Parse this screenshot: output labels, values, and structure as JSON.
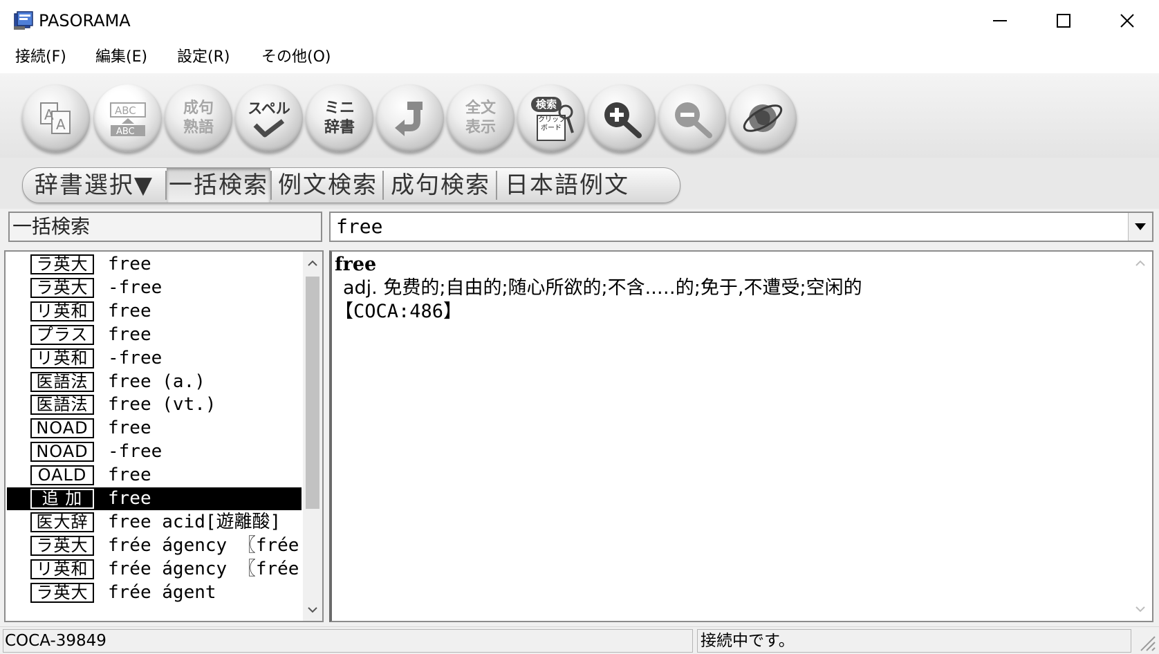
{
  "window": {
    "title": "PASORAMA"
  },
  "menu": [
    "接続(F)",
    "編集(E)",
    "設定(R)",
    "その他(O)"
  ],
  "toolbar": {
    "spell": "スペル",
    "mini_dict": "ミニ\n辞書",
    "idiom": "成句\n熟語",
    "full_text": "全文\n表示",
    "search_clip": "検索",
    "clipboard": "クリップ\nボード"
  },
  "tabs": [
    "辞書選択▼",
    "一括検索",
    "例文検索",
    "成句検索",
    "日本語例文"
  ],
  "search": {
    "mode": "一括検索",
    "value": "free"
  },
  "results": [
    {
      "dict": "ラ英大",
      "entry": "free"
    },
    {
      "dict": "ラ英大",
      "entry": "-free"
    },
    {
      "dict": "リ英和",
      "entry": "free"
    },
    {
      "dict": "プラス",
      "entry": "free"
    },
    {
      "dict": "リ英和",
      "entry": "-free"
    },
    {
      "dict": "医語法",
      "entry": "free (a.)"
    },
    {
      "dict": "医語法",
      "entry": "free (vt.)"
    },
    {
      "dict": "NOAD",
      "entry": "free"
    },
    {
      "dict": "NOAD",
      "entry": "-free"
    },
    {
      "dict": "OALD",
      "entry": "free"
    },
    {
      "dict": "追 加",
      "entry": "free",
      "selected": true
    },
    {
      "dict": "医大辞",
      "entry": "free acid[遊離酸]"
    },
    {
      "dict": "ラ英大",
      "entry": "frée ágency 〖frée"
    },
    {
      "dict": "リ英和",
      "entry": "frée ágency 〖frée"
    },
    {
      "dict": "ラ英大",
      "entry": "frée ágent"
    }
  ],
  "definition": {
    "headword": "free",
    "line1": "adj. 免费的;自由的;随心所欲的;不含..…的;免于,不遭受;空闲的",
    "line2": "【COCA:486】"
  },
  "status": {
    "left": "COCA-39849",
    "right": "接続中です。"
  },
  "colors": {
    "selection": "#000000",
    "chrome": "#f0f0f0",
    "accent": "#9a9a9a"
  }
}
